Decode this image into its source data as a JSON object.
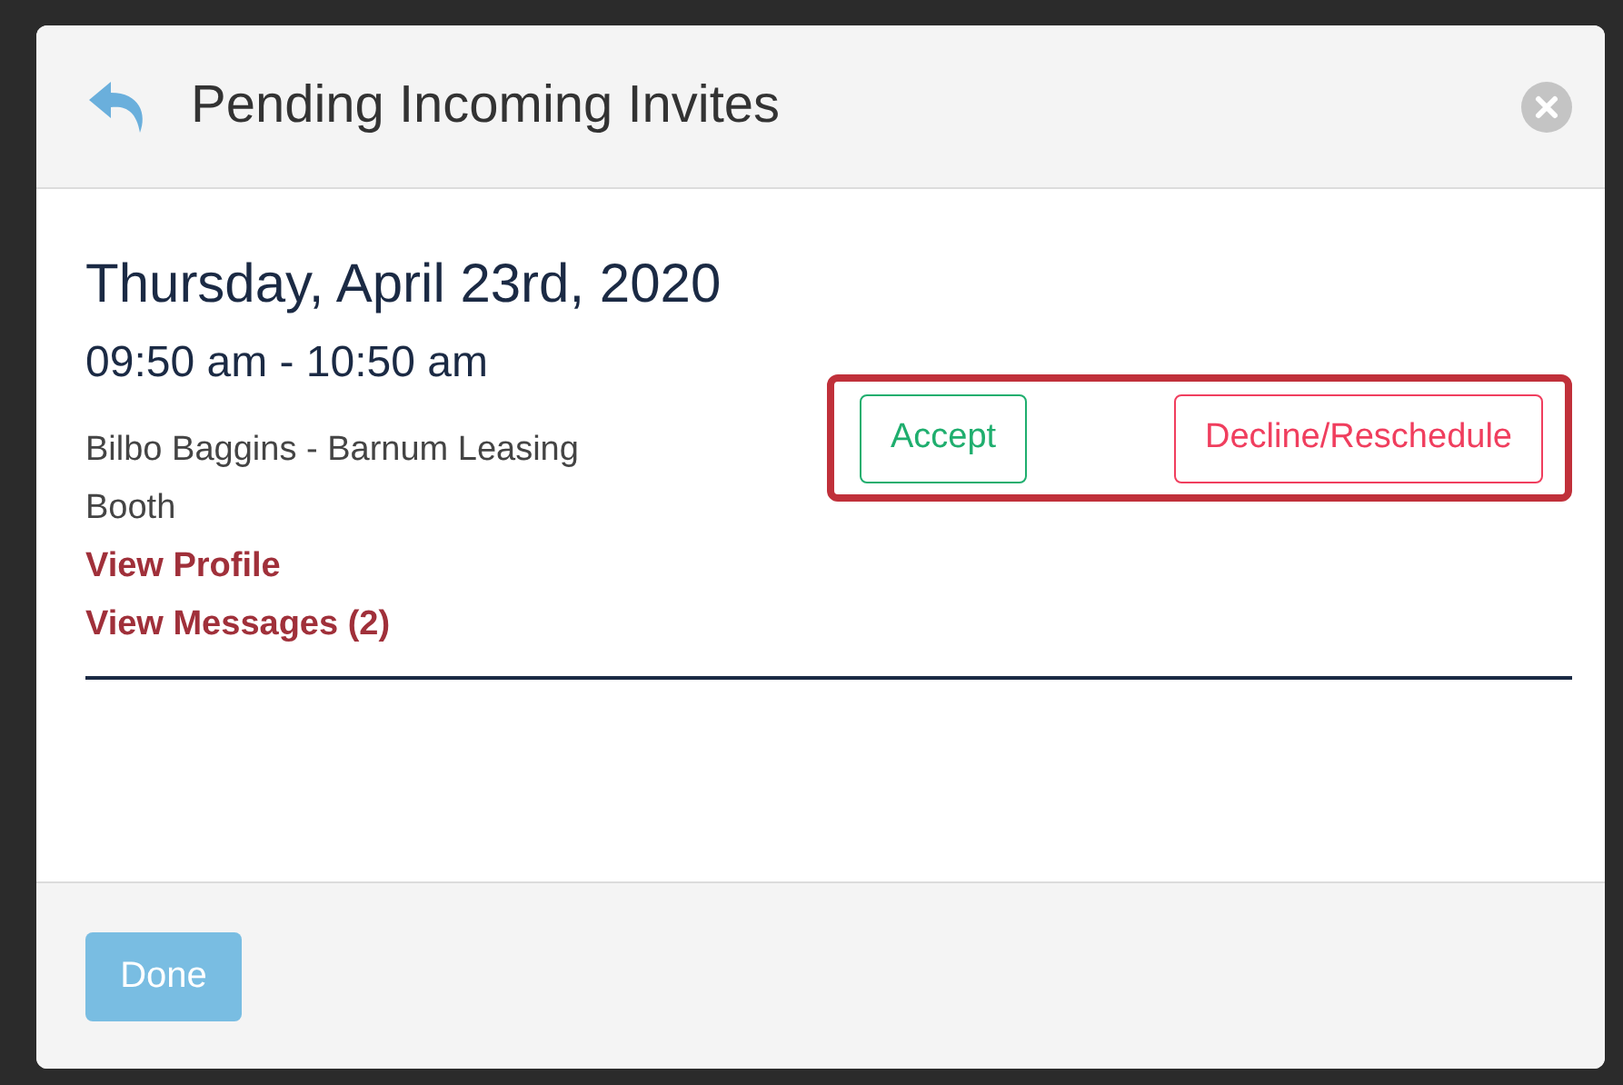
{
  "dialog": {
    "title": "Pending Incoming Invites"
  },
  "invite": {
    "date": "Thursday, April 23rd, 2020",
    "time": "09:50 am - 10:50 am",
    "attendee": "Bilbo Baggins - Barnum Leasing",
    "location": "Booth",
    "links": [
      "View Profile",
      "View Messages (2)"
    ],
    "actions": [
      {
        "label": "Accept",
        "kind": "accept"
      },
      {
        "label": "Decline/Reschedule",
        "kind": "decline"
      }
    ]
  },
  "footer": {
    "button": "Done"
  }
}
